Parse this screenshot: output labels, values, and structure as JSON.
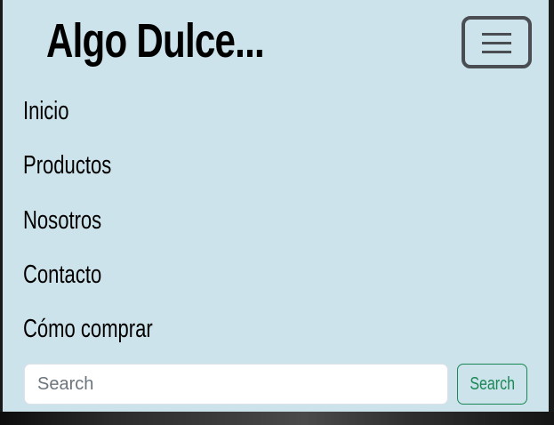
{
  "navbar": {
    "brand": "Algo Dulce...",
    "toggler_icon": "hamburger-icon",
    "links": [
      {
        "label": "Inicio"
      },
      {
        "label": "Productos"
      },
      {
        "label": "Nosotros"
      },
      {
        "label": "Contacto"
      },
      {
        "label": "Cómo comprar"
      }
    ]
  },
  "search": {
    "placeholder": "Search",
    "value": "",
    "button_label": "Search"
  },
  "colors": {
    "navbar_bg": "#cde3eb",
    "toggler_border": "#4a4d52",
    "search_button": "#198754",
    "page_bg": "#1a1a1a"
  }
}
